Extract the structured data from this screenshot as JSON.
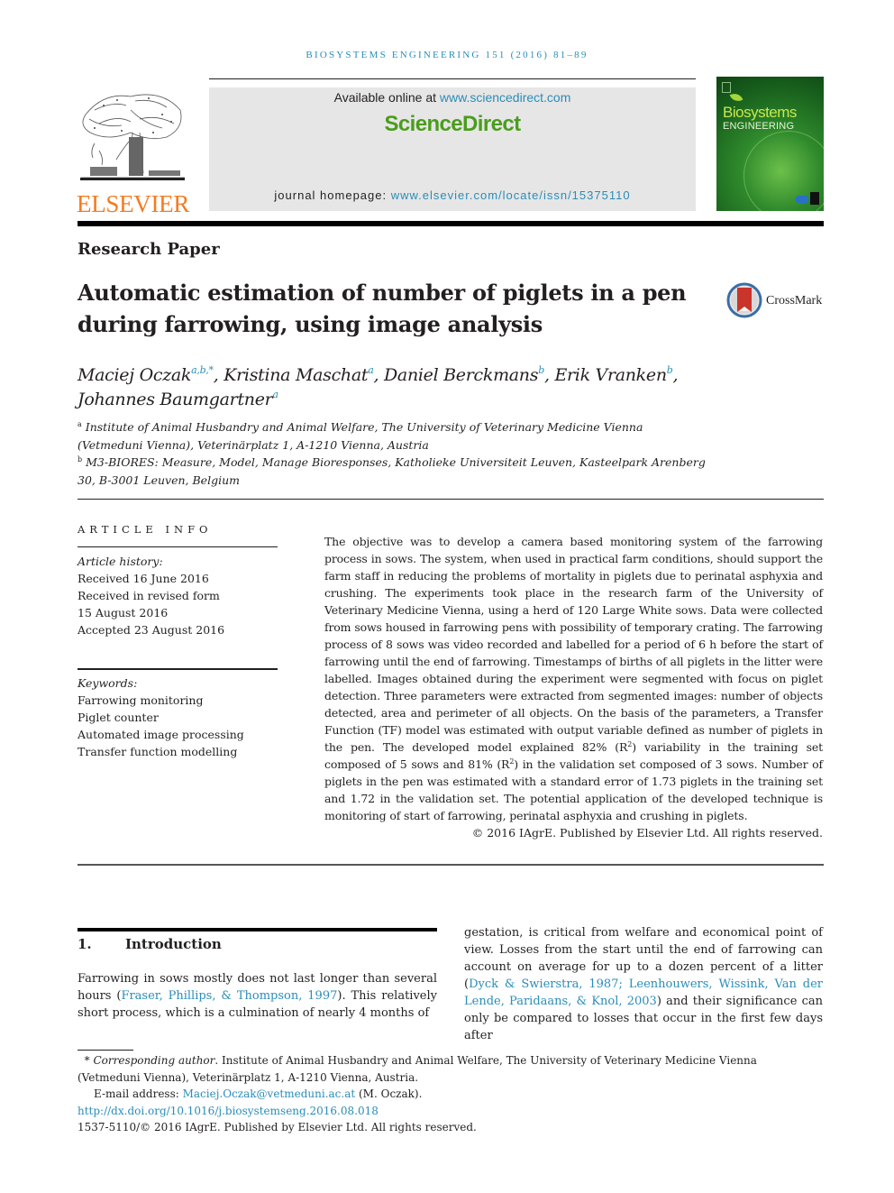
{
  "running_head": "BIOSYSTEMS ENGINEERING 151 (2016) 81–89",
  "publisher": {
    "logo_text": "ELSEVIER",
    "logo_icon": "elsevier-tree-icon"
  },
  "sciencedirect": {
    "available_prefix": "Available online at ",
    "available_link": "www.sciencedirect.com",
    "brand": "ScienceDirect",
    "homepage_prefix": "journal homepage: ",
    "homepage_link": "www.elsevier.com/locate/issn/15375110"
  },
  "journal_cover": {
    "title_line1": "Biosystems",
    "title_line2": "ENGINEERING"
  },
  "section_type": "Research Paper",
  "title_line1": "Automatic estimation of number of piglets in a pen",
  "title_line2": "during farrowing, using image analysis",
  "crossmark": {
    "label": "CrossMark",
    "icon": "crossmark-icon"
  },
  "authors": [
    {
      "name": "Maciej Oczak",
      "sup": "a,b,*",
      "sep": ", "
    },
    {
      "name": "Kristina Maschat",
      "sup": "a",
      "sep": ", "
    },
    {
      "name": "Daniel Berckmans",
      "sup": "b",
      "sep": ", "
    },
    {
      "name": "Erik Vranken",
      "sup": "b",
      "sep": ","
    },
    {
      "name": "Johannes Baumgartner",
      "sup": "a",
      "sep": ""
    }
  ],
  "affiliations": [
    {
      "key": "a",
      "text": "Institute of Animal Husbandry and Animal Welfare, The University of Veterinary Medicine Vienna (Vetmeduni Vienna), Veterinärplatz 1, A-1210 Vienna, Austria"
    },
    {
      "key": "b",
      "text": "M3-BIORES: Measure, Model, Manage Bioresponses, Katholieke Universiteit Leuven, Kasteelpark Arenberg 30, B-3001 Leuven, Belgium"
    }
  ],
  "article_info": {
    "heading": "ARTICLE INFO",
    "history_label": "Article history:",
    "history": [
      "Received 16 June 2016",
      "Received in revised form",
      "15 August 2016",
      "Accepted 23 August 2016"
    ],
    "keywords_label": "Keywords:",
    "keywords": [
      "Farrowing monitoring",
      "Piglet counter",
      "Automated image processing",
      "Transfer function modelling"
    ]
  },
  "abstract": {
    "part1": "The objective was to develop a camera based monitoring system of the farrowing process in sows. The system, when used in practical farm conditions, should support the farm staff in reducing the problems of mortality in piglets due to perinatal asphyxia and crushing. The experiments took place in the research farm of the University of Veterinary Medicine Vienna, using a herd of 120 Large White sows. Data were collected from sows housed in farrowing pens with possibility of temporary crating. The farrowing process of 8 sows was video recorded and labelled for a period of 6 h before the start of farrowing until the end of farrowing. Timestamps of births of all piglets in the litter were labelled. Images obtained during the experiment were segmented with focus on piglet detection. Three parameters were extracted from segmented images: number of objects detected, area and perimeter of all objects. On the basis of the parameters, a Transfer Function (TF) model was estimated with output variable defined as number of piglets in the pen. The developed model explained 82% (R",
    "sup1": "2",
    "part2": ") variability in the training set composed of 5 sows and 81% (R",
    "sup2": "2",
    "part3": ") in the validation set composed of 3 sows. Number of piglets in the pen was estimated with a standard error of 1.73 piglets in the training set and 1.72 in the validation set. The potential application of the developed technique is monitoring of start of farrowing, perinatal asphyxia and crushing in piglets.",
    "copyright": "© 2016 IAgrE. Published by Elsevier Ltd. All rights reserved."
  },
  "introduction": {
    "number": "1.",
    "heading": "Introduction",
    "left_p1": "Farrowing in sows mostly does not last longer than several hours (",
    "left_cite1": "Fraser, Phillips, & Thompson, 1997",
    "left_p2": "). This relatively short process, which is a culmination of nearly 4 months of",
    "right_p1": "gestation, is critical from welfare and economical point of view. Losses from the start until the end of farrowing can account on average for up to a dozen percent of a litter (",
    "right_cite1": "Dyck & Swierstra, 1987; Leenhouwers, Wissink, Van der Lende, Paridaans, & Knol, 2003",
    "right_p2": ") and their significance can only be compared to losses that occur in the first few days after"
  },
  "footnotes": {
    "corresponding_star": "*",
    "corresponding_label": "Corresponding author",
    "corresponding_text": ". Institute of Animal Husbandry and Animal Welfare, The University of Veterinary Medicine Vienna (Vetmeduni Vienna), Veterinärplatz 1, A-1210 Vienna, Austria.",
    "email_label": "E-mail address: ",
    "email": "Maciej.Oczak@vetmeduni.ac.at",
    "email_suffix": " (M. Oczak).",
    "doi": "http://dx.doi.org/10.1016/j.biosystemseng.2016.08.018",
    "issn_line": "1537-5110/© 2016 IAgrE. Published by Elsevier Ltd. All rights reserved."
  },
  "colors": {
    "link": "#2a8db8",
    "elsevier_orange": "#f47b20",
    "sciencedirect_green": "#4a9d1c",
    "header_box": "#e6e6e6"
  }
}
